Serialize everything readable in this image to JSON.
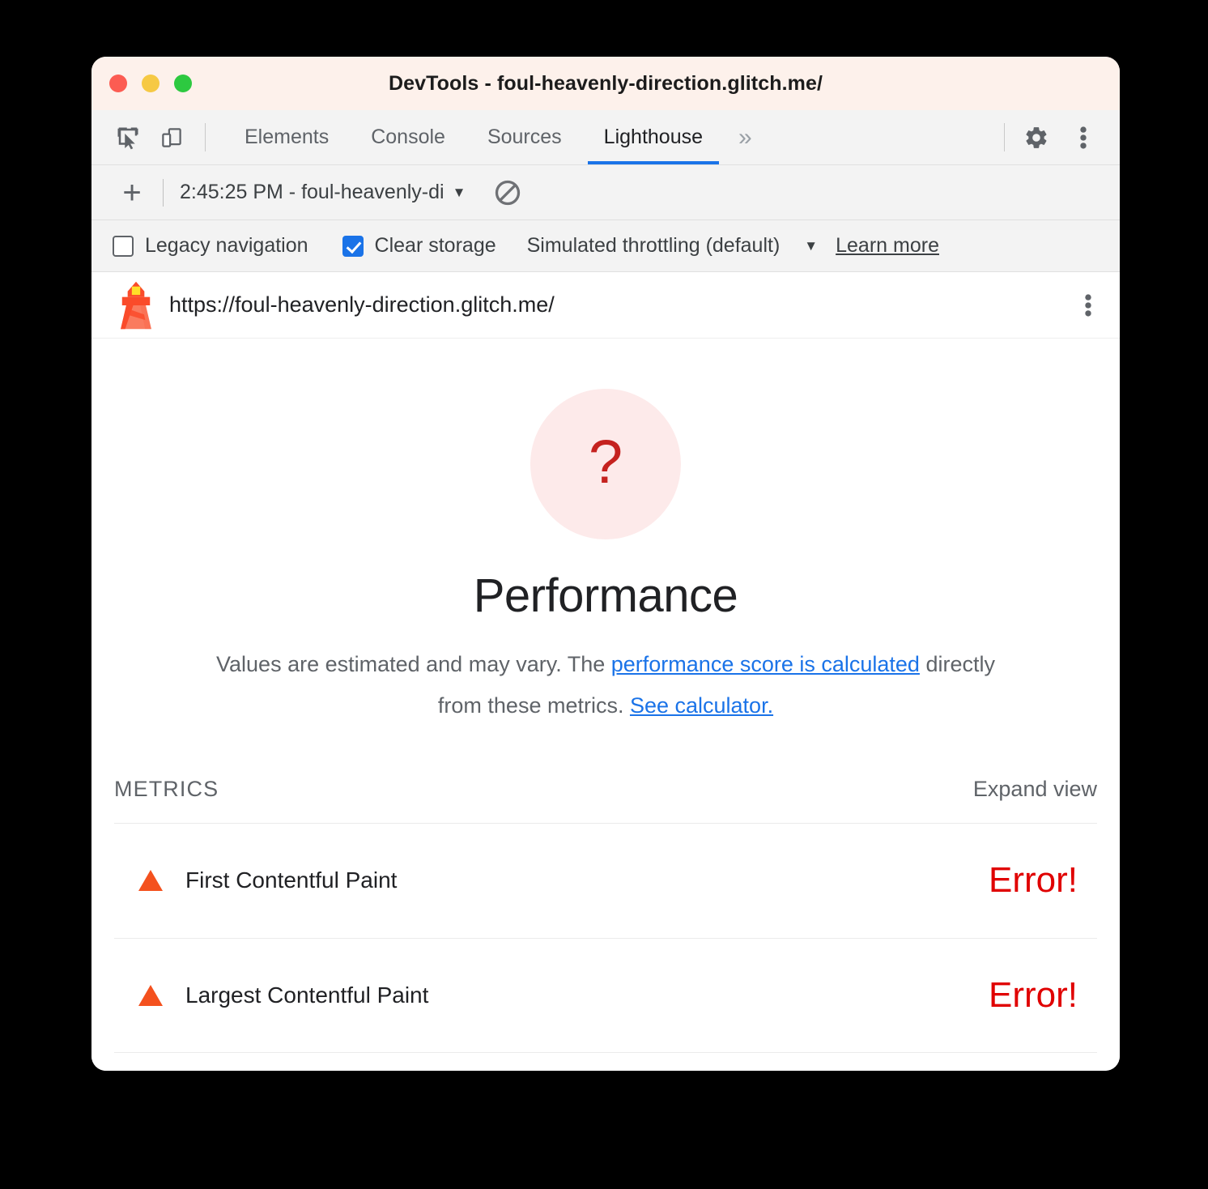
{
  "window": {
    "title": "DevTools - foul-heavenly-direction.glitch.me/",
    "traffic_lights": [
      "close",
      "minimize",
      "maximize"
    ]
  },
  "tabbar": {
    "inspect_icon": "inspect-element-icon",
    "device_icon": "device-toolbar-icon",
    "tabs": [
      {
        "label": "Elements",
        "active": false
      },
      {
        "label": "Console",
        "active": false
      },
      {
        "label": "Sources",
        "active": false
      },
      {
        "label": "Lighthouse",
        "active": true
      }
    ],
    "more_tabs": "»",
    "settings_icon": "gear-icon",
    "menu_icon": "kebab-menu-icon",
    "active_tab_color": "#1a73e8"
  },
  "lh_toolbar": {
    "add_label": "+",
    "report_selected": "2:45:25 PM - foul-heavenly-di",
    "caret": "▼",
    "clear_icon": "clear-all-icon"
  },
  "options": {
    "legacy_navigation": {
      "label": "Legacy navigation",
      "checked": false
    },
    "clear_storage": {
      "label": "Clear storage",
      "checked": true
    },
    "throttling": {
      "label": "Simulated throttling (default)",
      "caret": "▼"
    },
    "learn_more": "Learn more"
  },
  "report_header": {
    "logo": "lighthouse-icon",
    "url": "https://foul-heavenly-direction.glitch.me/",
    "kebab_icon": "kebab-menu-icon"
  },
  "report": {
    "gauge": {
      "score_text": "?",
      "circle_color": "#fdeaea",
      "text_color": "#c5221f"
    },
    "category_title": "Performance",
    "description_part1": "Values are estimated and may vary. The ",
    "description_link1": "performance score is calculated",
    "description_part2": " directly from these metrics. ",
    "description_link2": "See calculator.",
    "metrics_title": "METRICS",
    "expand_view": "Expand view",
    "metrics": [
      {
        "icon": "error-triangle-icon",
        "name": "First Contentful Paint",
        "value": "Error!"
      },
      {
        "icon": "error-triangle-icon",
        "name": "Largest Contentful Paint",
        "value": "Error!"
      }
    ],
    "error_color": "#e00000",
    "triangle_color": "#f4511e"
  }
}
